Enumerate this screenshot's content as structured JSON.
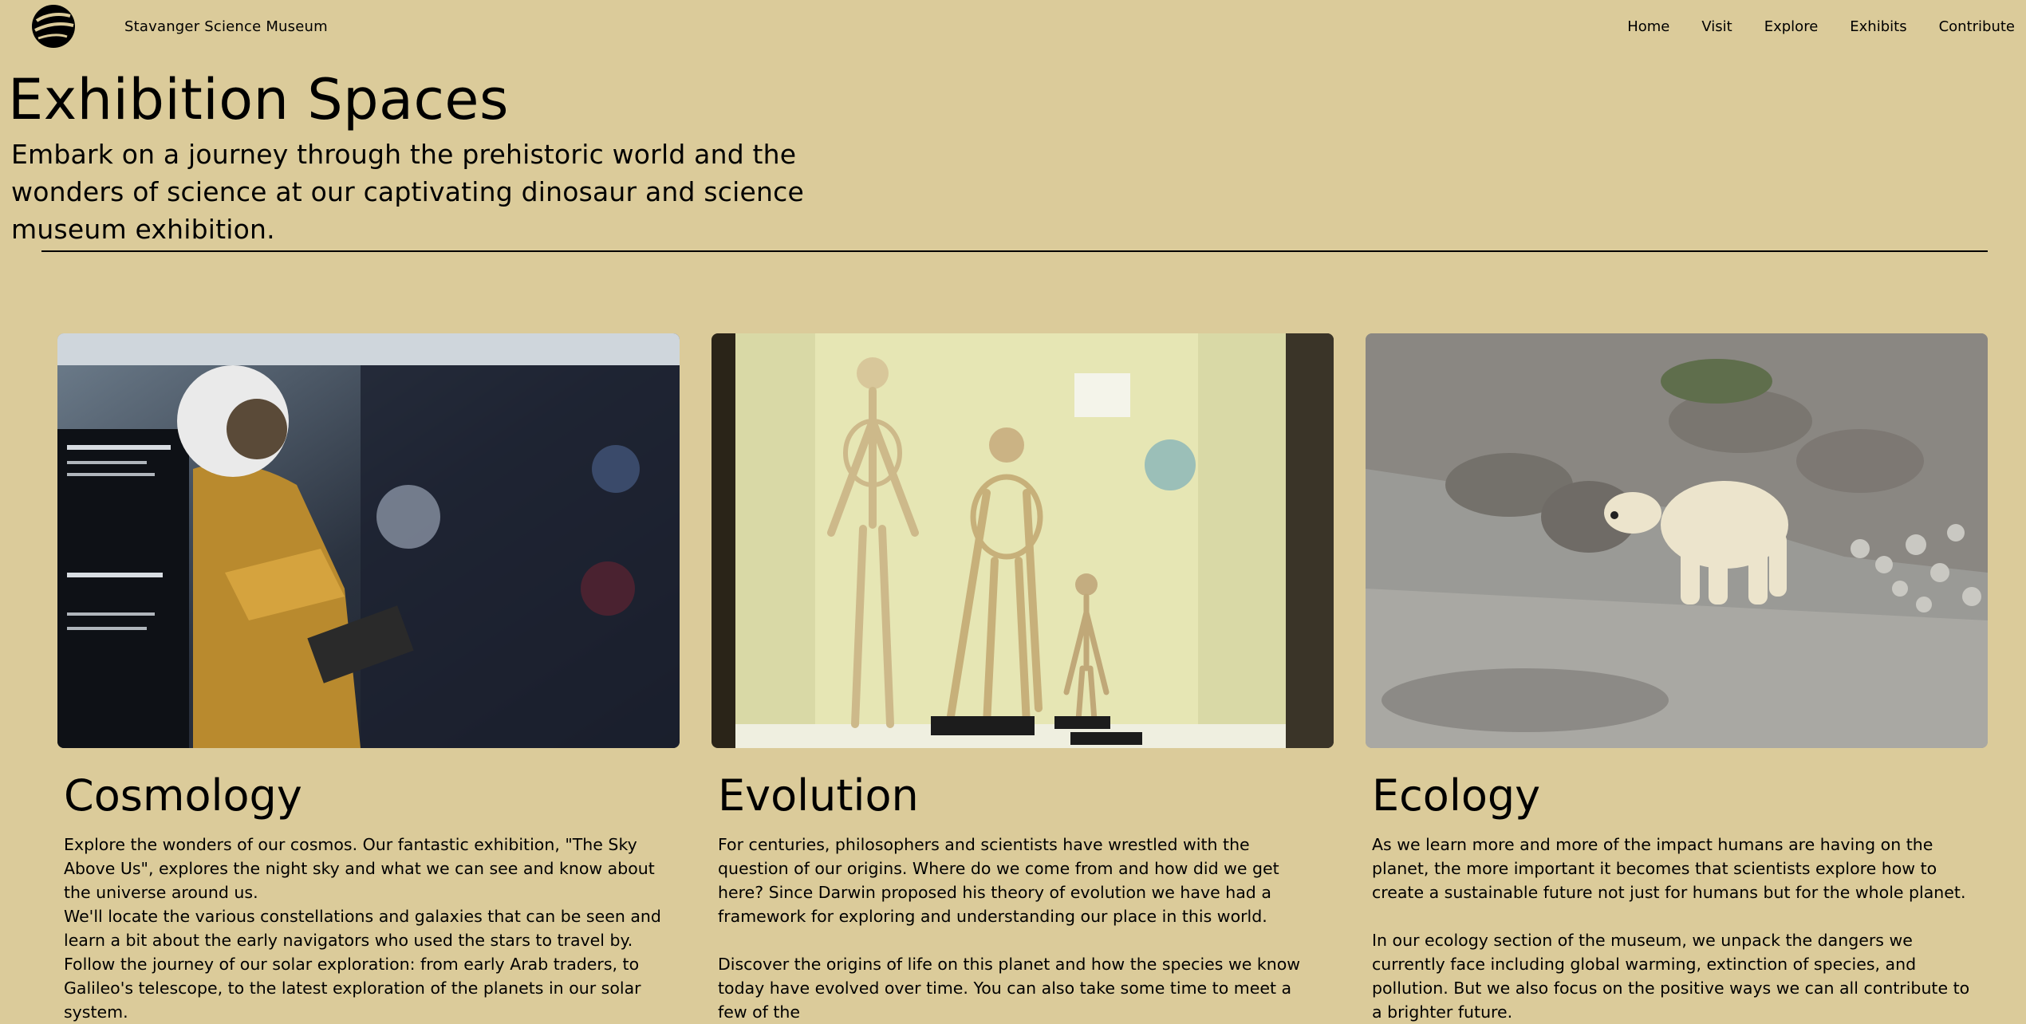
{
  "header": {
    "site_name": "Stavanger Science Museum",
    "logo_icon": "museum-logo-icon",
    "nav": [
      "Home",
      "Visit",
      "Explore",
      "Exhibits",
      "Contribute"
    ]
  },
  "hero": {
    "title": "Exhibition Spaces",
    "subtitle": "Embark on a journey through the prehistoric world and the wonders of science at our captivating dinosaur and science museum exhibition."
  },
  "cards": [
    {
      "title": "Cosmology",
      "image": "astronaut-exhibit-photo",
      "paragraphs": [
        "Explore the wonders of our cosmos. Our fantastic exhibition, \"The Sky Above Us\", explores the night sky and what we can see and know about the universe around us.",
        "We'll locate the various constellations and galaxies that can be seen and learn a bit about the early navigators who used the stars to travel by. Follow the journey of our solar exploration: from early Arab traders, to Galileo's telescope, to the latest exploration of the planets in our solar system."
      ]
    },
    {
      "title": "Evolution",
      "image": "primate-skeletons-photo",
      "paragraphs": [
        "For centuries, philosophers and scientists have wrestled with the question of our origins. Where do we come from and how did we get here? Since Darwin proposed his theory of evolution we have had a framework for exploring and understanding our place in this world.",
        "Discover the origins of life on this planet and how the species we know today have evolved over time. You can also take some time to meet a few of the"
      ]
    },
    {
      "title": "Ecology",
      "image": "polar-bear-photo",
      "paragraphs": [
        "As we learn more and more of the impact humans are having on the planet, the more important it becomes that scientists explore how to create a sustainable future not just for humans but for the whole planet.",
        "In our ecology section of the museum, we unpack the dangers we currently face including global warming, extinction of species, and pollution. But we also focus on the positive ways we can all contribute to a brighter future."
      ]
    }
  ],
  "colors": {
    "background": "#dbcb9a",
    "text": "#000000"
  }
}
